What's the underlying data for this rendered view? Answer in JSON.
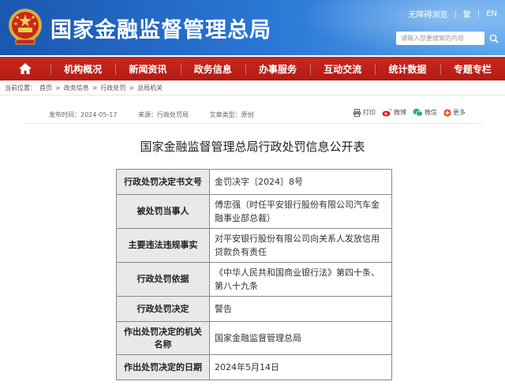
{
  "header": {
    "site_title": "国家金融监督管理总局",
    "accessibility_label": "无障碍浏览",
    "lang_zh": "繁",
    "lang_en": "EN",
    "search_placeholder": "请输入您要搜索的内容"
  },
  "nav": {
    "home_icon": "home-icon",
    "items": [
      {
        "label": "机构概况"
      },
      {
        "label": "新闻资讯"
      },
      {
        "label": "政务信息"
      },
      {
        "label": "办事服务"
      },
      {
        "label": "互动交流"
      },
      {
        "label": "统计数据"
      },
      {
        "label": "专题专栏"
      }
    ]
  },
  "breadcrumb": {
    "prefix": "当前位置：",
    "items": [
      "首页",
      "政务信息",
      "行政处罚",
      "总局机关"
    ]
  },
  "meta": {
    "publish_time": "发布时间：2024-05-17",
    "source": "来源：行政处罚局",
    "article_type": "文章类型：原创"
  },
  "share": {
    "print": "打印",
    "weibo": "微博",
    "wechat": "微信",
    "more": "更多"
  },
  "article": {
    "title": "国家金融监督管理总局行政处罚信息公开表"
  },
  "table": {
    "rows": [
      {
        "key": "行政处罚决定书文号",
        "value": "金罚决字〔2024〕8号"
      },
      {
        "key": "被处罚当事人",
        "value": "傅忠强（时任平安银行股份有限公司汽车金融事业部总裁）"
      },
      {
        "key": "主要违法违规事实",
        "value": "对平安银行股份有限公司向关系人发放信用贷款负有责任"
      },
      {
        "key": "行政处罚依据",
        "value": "《中华人民共和国商业银行法》第四十条、第八十九条"
      },
      {
        "key": "行政处罚决定",
        "value": "警告"
      },
      {
        "key": "作出处罚决定的机关名称",
        "value": "国家金融监督管理总局"
      },
      {
        "key": "作出处罚决定的日期",
        "value": "2024年5月14日"
      }
    ]
  },
  "colors": {
    "header_blue": "#1a57b0",
    "nav_red": "#c8281e",
    "table_key_bg": "#e9e9e9"
  }
}
